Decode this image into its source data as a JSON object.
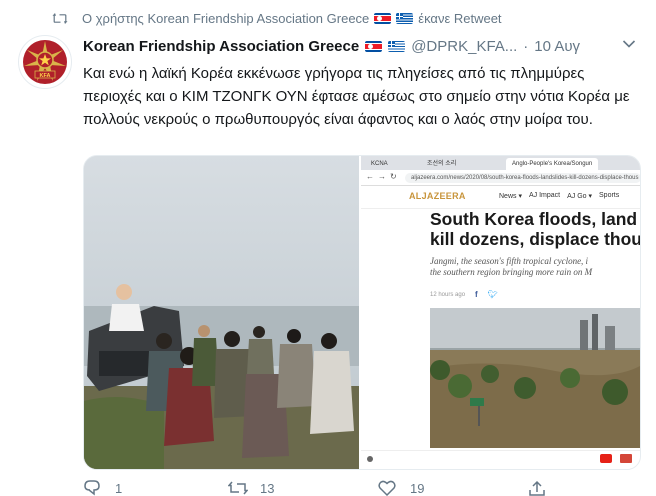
{
  "retweet": {
    "prefix": "Ο χρήστης Korean Friendship Association Greece",
    "suffix": "έκανε Retweet"
  },
  "author": {
    "name": "Korean Friendship Association Greece",
    "handle": "@DPRK_KFA...",
    "separator": "·",
    "date": "10 Αυγ",
    "avatar_text": "KFA"
  },
  "tweet": {
    "text": "Και ενώ η λαϊκή Κορέα εκκένωσε γρήγορα τις πληγείσες από τις πλημμύρες περιοχές και ο ΚΙΜ ΤΖΟΝΓΚ ΟΥΝ έφτασε αμέσως στο σημείο στην νότια Κορέα με πολλούς νεκρούς ο πρωθυπουργός είναι άφαντος και ο λαός στην μοίρα του."
  },
  "screenshot": {
    "tabs": [
      "KCNA",
      "조선의 소리",
      "Anglo-People's Korea/Songun"
    ],
    "url": "aljazeera.com/news/2020/08/south-korea-floods-landslides-kill-dozens-displace-thous",
    "site_logo": "ALJAZEERA",
    "nav": [
      "News ▾",
      "AJ Impact",
      "AJ Go ▾",
      "Sports"
    ],
    "headline_1": "South Korea floods, land",
    "headline_2": "kill dozens, displace thou",
    "summary_1": "Jangmi, the season's fifth tropical cyclone, i",
    "summary_2": "the southern region bringing more rain on M",
    "time": "12 hours ago"
  },
  "actions": {
    "replies": "1",
    "retweets": "13",
    "likes": "19"
  },
  "colors": {
    "link_gray": "#657786",
    "kfa_red": "#b0202a",
    "aljazeera_gold": "#c8953c"
  }
}
